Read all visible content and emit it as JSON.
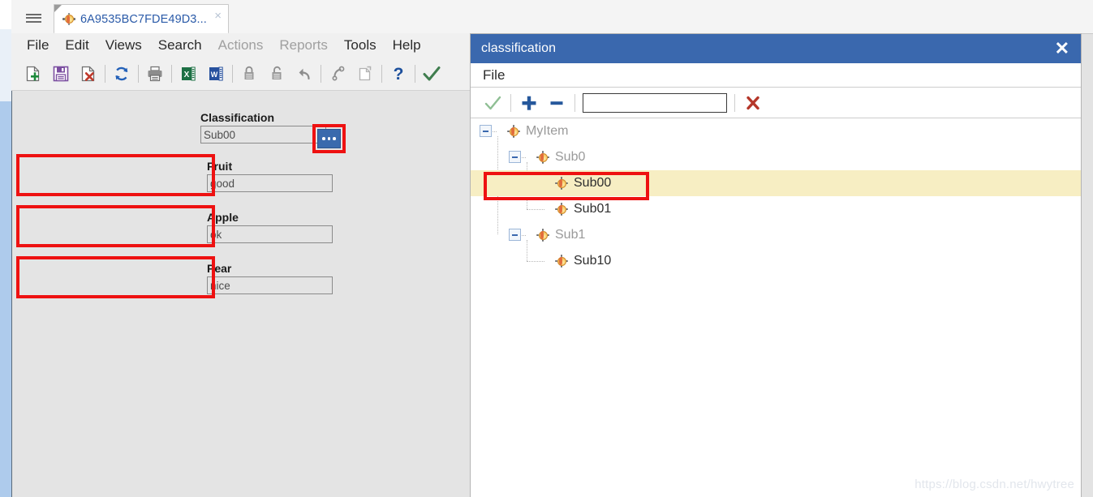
{
  "main_window": {
    "tab": {
      "label": "6A9535BC7FDE49D3...",
      "icon": "node-sphere-icon",
      "close_label": "×"
    },
    "hamburger_icon": "hamburger-menu-icon",
    "menubar": [
      {
        "label": "File",
        "disabled": false
      },
      {
        "label": "Edit",
        "disabled": false
      },
      {
        "label": "Views",
        "disabled": false
      },
      {
        "label": "Search",
        "disabled": false
      },
      {
        "label": "Actions",
        "disabled": true
      },
      {
        "label": "Reports",
        "disabled": true
      },
      {
        "label": "Tools",
        "disabled": false
      },
      {
        "label": "Help",
        "disabled": false
      }
    ],
    "toolbar": [
      {
        "icon": "new-document-icon",
        "name": "new-button"
      },
      {
        "icon": "save-icon",
        "name": "save-button"
      },
      {
        "icon": "delete-document-icon",
        "name": "delete-button"
      },
      {
        "icon": "separator",
        "name": "toolbar-separator-1"
      },
      {
        "icon": "refresh-icon",
        "name": "refresh-button"
      },
      {
        "icon": "separator",
        "name": "toolbar-separator-2"
      },
      {
        "icon": "print-icon",
        "name": "print-button"
      },
      {
        "icon": "separator",
        "name": "toolbar-separator-3"
      },
      {
        "icon": "excel-export-icon",
        "name": "export-excel-button"
      },
      {
        "icon": "word-export-icon",
        "name": "export-word-button"
      },
      {
        "icon": "separator",
        "name": "toolbar-separator-4"
      },
      {
        "icon": "lock-closed-icon",
        "name": "lock-button"
      },
      {
        "icon": "lock-open-icon",
        "name": "unlock-button"
      },
      {
        "icon": "undo-icon",
        "name": "undo-button"
      },
      {
        "icon": "separator",
        "name": "toolbar-separator-5"
      },
      {
        "icon": "redo-icon",
        "name": "redo-button"
      },
      {
        "icon": "copy-icon",
        "name": "copy-button"
      },
      {
        "icon": "separator",
        "name": "toolbar-separator-6"
      },
      {
        "icon": "help-question-icon",
        "name": "help-button"
      },
      {
        "icon": "separator",
        "name": "toolbar-separator-7"
      },
      {
        "icon": "check-icon",
        "name": "apply-button"
      }
    ],
    "form": {
      "classification": {
        "label": "Classification",
        "value": "Sub00",
        "placeholder": "",
        "browse_button_label": "...",
        "browse_button_icon": "ellipsis-icon"
      },
      "fields": [
        {
          "label": "Fruit",
          "value": "good",
          "placeholder": ""
        },
        {
          "label": "Apple",
          "value": "ok",
          "placeholder": ""
        },
        {
          "label": "Pear",
          "value": "nice",
          "placeholder": ""
        }
      ]
    }
  },
  "dialog": {
    "title": "classification",
    "close_icon": "close-x-icon",
    "close_label": "✕",
    "menubar": [
      {
        "label": "File"
      }
    ],
    "toolbar": {
      "confirm_icon": "check-icon",
      "add_icon": "plus-icon",
      "remove_icon": "minus-icon",
      "delete_icon": "red-x-icon",
      "search_value": "",
      "search_placeholder": ""
    },
    "tree": [
      {
        "label": "MyItem",
        "depth": 0,
        "expanded": true,
        "has_children": true,
        "selected": false
      },
      {
        "label": "Sub0",
        "depth": 1,
        "expanded": true,
        "has_children": true,
        "selected": false
      },
      {
        "label": "Sub00",
        "depth": 2,
        "expanded": false,
        "has_children": false,
        "selected": true
      },
      {
        "label": "Sub01",
        "depth": 2,
        "expanded": false,
        "has_children": false,
        "selected": false
      },
      {
        "label": "Sub1",
        "depth": 1,
        "expanded": true,
        "has_children": true,
        "selected": false
      },
      {
        "label": "Sub10",
        "depth": 2,
        "expanded": false,
        "has_children": false,
        "selected": false
      }
    ],
    "watermark": "https://blog.csdn.net/hwytree"
  },
  "colors": {
    "dialog_title_bar": "#3a68ae",
    "selection_row": "#f7eec3",
    "highlight_rect": "#ee1111",
    "browse_button": "#3a6aad",
    "tab_text": "#2a5aa8",
    "leaf_text": "#2e2e2e",
    "parent_text": "#9a9a9a"
  }
}
